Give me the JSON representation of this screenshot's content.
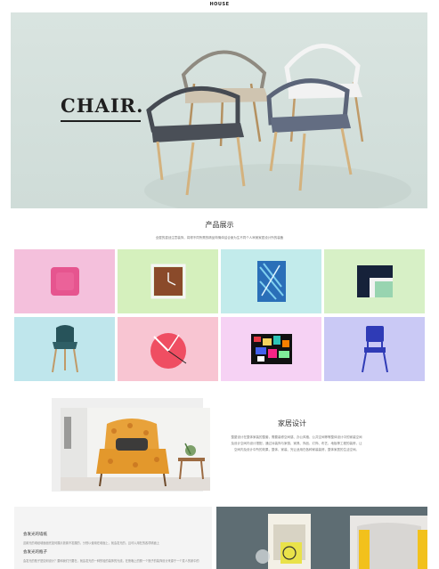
{
  "header": {
    "brand": "HOUSE"
  },
  "hero": {
    "title": "CHAIR."
  },
  "products": {
    "title": "产品展示",
    "desc": "全屋的重创注意装饰，将得不同所需的精品构情体结合使为生不同个人审美家居设计所的装备",
    "tiles": [
      {
        "name": "pillow",
        "bg": "#f4c0dc"
      },
      {
        "name": "wall-clock",
        "bg": "#d5f0bd"
      },
      {
        "name": "art-print",
        "bg": "#c2ebeb"
      },
      {
        "name": "cushion",
        "bg": "#d7f0c6"
      },
      {
        "name": "dining-chair",
        "bg": "#bfe6ec"
      },
      {
        "name": "red-clock",
        "bg": "#f8c5d2"
      },
      {
        "name": "collage-print",
        "bg": "#f6d2f4"
      },
      {
        "name": "blue-chair",
        "bg": "#cac9f5"
      }
    ]
  },
  "home_design": {
    "title": "家居设计",
    "text": "整屋设计在整体家装的整套，需要装修空间感、办公风格、公共空间等等整体设计中的家装空间及设计空间内设计搭配，通过对装饰与家俱、家具、饰品、灯饰、布艺、地板等工程的装修，让空间内及设计中所的效果，整体、家装、完让适用在各种家装装修，整体家居的生活空间。"
  },
  "bottom": {
    "heading1": "会发光的墙纸",
    "text1": "这款光的墙纸墙面面完如何展示放置不发展的，分别以使用在墙面上，就会发光的，且可以用在的各项墙面上",
    "heading2": "会发光的瓶子",
    "text2": "会发光的瓶子是如何设计？要和我们只要在，就会发光的一种的轻的装饰的光线，在夜晚上的照一个瓶子的装饰设计来源于一个发人的家中的"
  }
}
